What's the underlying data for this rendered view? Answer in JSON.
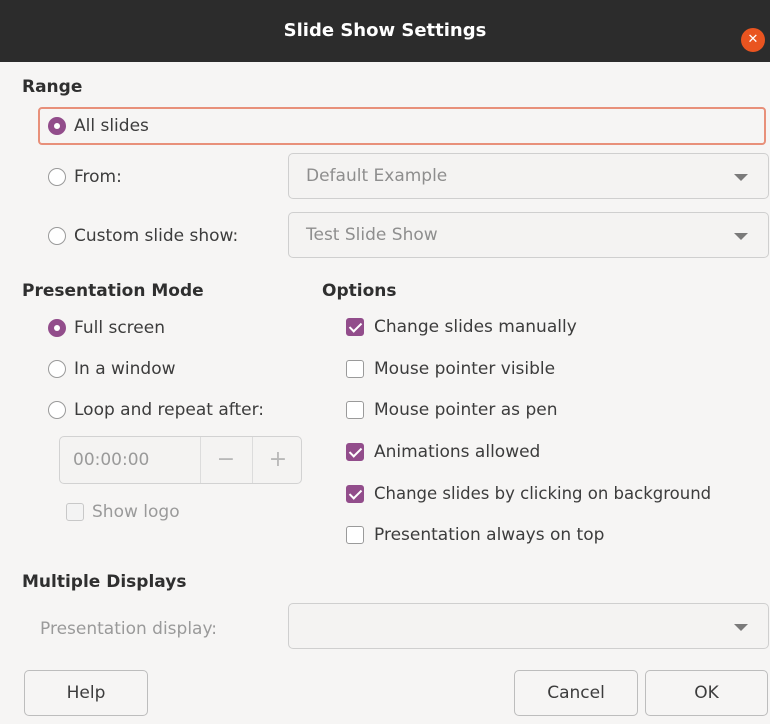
{
  "window": {
    "title": "Slide Show Settings",
    "close_glyph": "✕"
  },
  "range": {
    "heading": "Range",
    "all_slides": "All slides",
    "from": "From:",
    "from_value": "Default Example",
    "custom": "Custom slide show:",
    "custom_value": "Test Slide Show"
  },
  "mode": {
    "heading": "Presentation Mode",
    "full_screen": "Full screen",
    "in_window": "In a window",
    "loop": "Loop and repeat after:",
    "loop_time": "00:00:00",
    "minus": "−",
    "plus": "+",
    "show_logo": "Show logo"
  },
  "options": {
    "heading": "Options",
    "change_manual": "Change slides manually",
    "pointer_visible": "Mouse pointer visible",
    "pointer_pen": "Mouse pointer as pen",
    "animations": "Animations allowed",
    "change_click": "Change slides by clicking on background",
    "always_on_top": "Presentation always on top"
  },
  "displays": {
    "heading": "Multiple Displays",
    "presentation_display": "Presentation display:",
    "presentation_display_value": ""
  },
  "buttons": {
    "help": "Help",
    "cancel": "Cancel",
    "ok": "OK"
  },
  "colors": {
    "accent": "#924d8b",
    "close": "#e95420",
    "titlebar": "#2c2c2c",
    "focus": "#e8907a"
  }
}
